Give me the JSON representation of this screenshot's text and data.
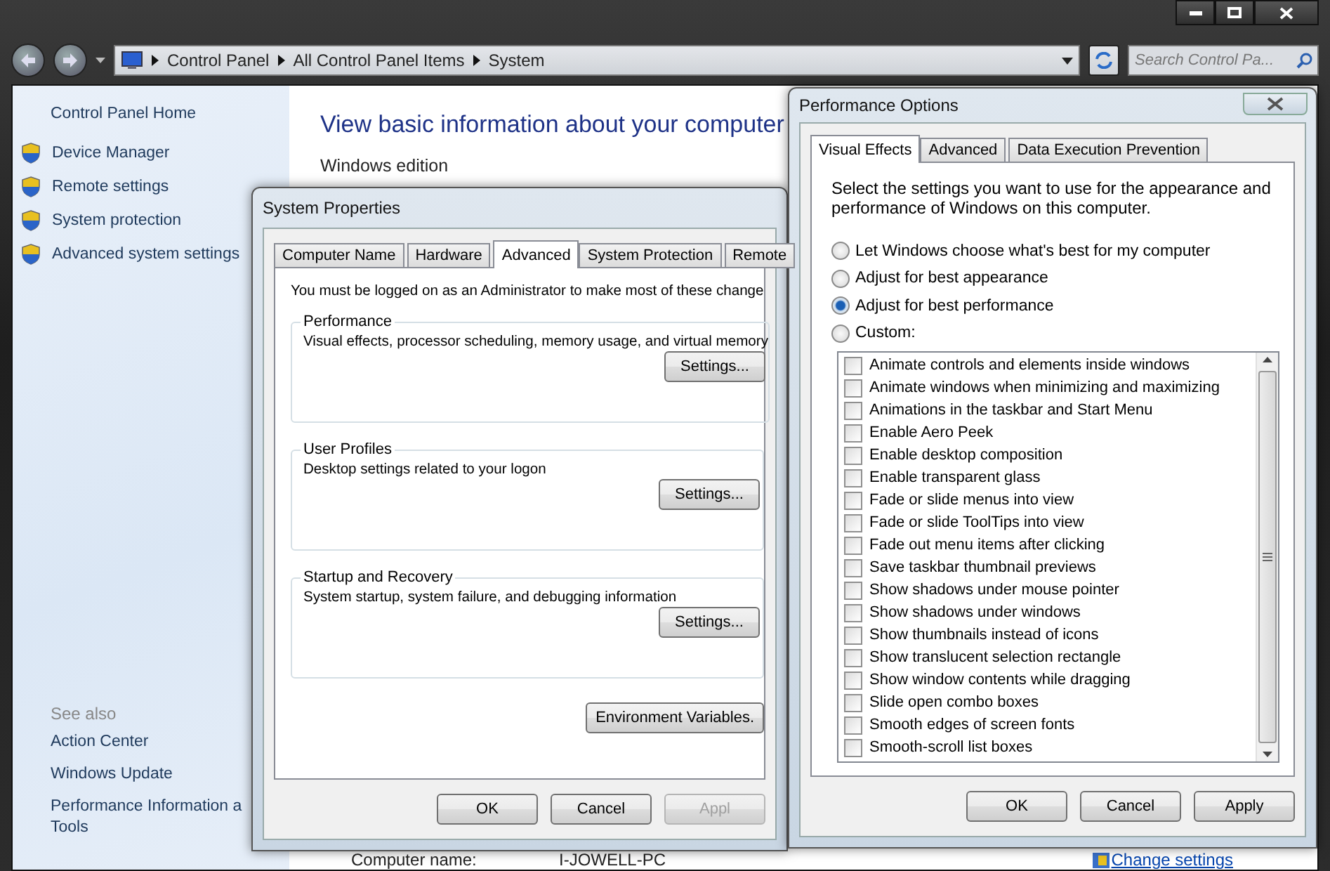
{
  "window": {
    "breadcrumbs": [
      {
        "label": "Control Panel"
      },
      {
        "label": "All Control Panel Items"
      },
      {
        "label": "System"
      }
    ],
    "search": {
      "placeholder": "Search Control Pa..."
    }
  },
  "sidebar": {
    "home": "Control Panel Home",
    "tasks": [
      {
        "label": "Device Manager"
      },
      {
        "label": "Remote settings"
      },
      {
        "label": "System protection"
      },
      {
        "label": "Advanced system settings"
      }
    ],
    "see_also_title": "See also",
    "see_also": [
      {
        "lines": [
          "Action Center"
        ]
      },
      {
        "lines": [
          "Windows Update"
        ]
      },
      {
        "lines": [
          "Performance Information a",
          "Tools"
        ]
      }
    ]
  },
  "main": {
    "heading": "View basic information about your computer",
    "section": "Windows edition",
    "computer_name_label": "Computer name:",
    "computer_name": "I-JOWELL-PC",
    "change_settings": "Change settings"
  },
  "system_properties": {
    "title": "System Properties",
    "tabs": [
      {
        "label": "Computer Name",
        "selected": false
      },
      {
        "label": "Hardware",
        "selected": false
      },
      {
        "label": "Advanced",
        "selected": true
      },
      {
        "label": "System Protection",
        "selected": false
      },
      {
        "label": "Remote",
        "selected": false
      }
    ],
    "notice": "You must be logged on as an Administrator to make most of these change",
    "groups": [
      {
        "title": "Performance",
        "description": "Visual effects, processor scheduling, memory usage, and virtual memory",
        "button": "Settings..."
      },
      {
        "title": "User Profiles",
        "description": "Desktop settings related to your logon",
        "button": "Settings..."
      },
      {
        "title": "Startup and Recovery",
        "description": "System startup, system failure, and debugging information",
        "button": "Settings..."
      }
    ],
    "env_button": "Environment Variables.",
    "buttons": [
      {
        "label": "OK",
        "disabled": false
      },
      {
        "label": "Cancel",
        "disabled": false
      },
      {
        "label": "Appl",
        "disabled": true
      }
    ]
  },
  "performance_options": {
    "title": "Performance Options",
    "tabs": [
      {
        "label": "Visual Effects",
        "selected": true
      },
      {
        "label": "Advanced",
        "selected": false
      },
      {
        "label": "Data Execution Prevention",
        "selected": false
      }
    ],
    "description": "Select the settings you want to use for the appearance and performance of Windows on this computer.",
    "options": [
      {
        "label": "Let Windows choose what's best for my computer",
        "selected": false
      },
      {
        "label": "Adjust for best appearance",
        "selected": false
      },
      {
        "label": "Adjust for best performance",
        "selected": true
      },
      {
        "label": "Custom:",
        "selected": false
      }
    ],
    "effects": [
      {
        "label": "Animate controls and elements inside windows",
        "checked": false
      },
      {
        "label": "Animate windows when minimizing and maximizing",
        "checked": false
      },
      {
        "label": "Animations in the taskbar and Start Menu",
        "checked": false
      },
      {
        "label": "Enable Aero Peek",
        "checked": false
      },
      {
        "label": "Enable desktop composition",
        "checked": false
      },
      {
        "label": "Enable transparent glass",
        "checked": false
      },
      {
        "label": "Fade or slide menus into view",
        "checked": false
      },
      {
        "label": "Fade or slide ToolTips into view",
        "checked": false
      },
      {
        "label": "Fade out menu items after clicking",
        "checked": false
      },
      {
        "label": "Save taskbar thumbnail previews",
        "checked": false
      },
      {
        "label": "Show shadows under mouse pointer",
        "checked": false
      },
      {
        "label": "Show shadows under windows",
        "checked": false
      },
      {
        "label": "Show thumbnails instead of icons",
        "checked": false
      },
      {
        "label": "Show translucent selection rectangle",
        "checked": false
      },
      {
        "label": "Show window contents while dragging",
        "checked": false
      },
      {
        "label": "Slide open combo boxes",
        "checked": false
      },
      {
        "label": "Smooth edges of screen fonts",
        "checked": false
      },
      {
        "label": "Smooth-scroll list boxes",
        "checked": false
      }
    ],
    "buttons": [
      {
        "label": "OK",
        "disabled": false
      },
      {
        "label": "Cancel",
        "disabled": false
      },
      {
        "label": "Apply",
        "disabled": false
      }
    ]
  }
}
